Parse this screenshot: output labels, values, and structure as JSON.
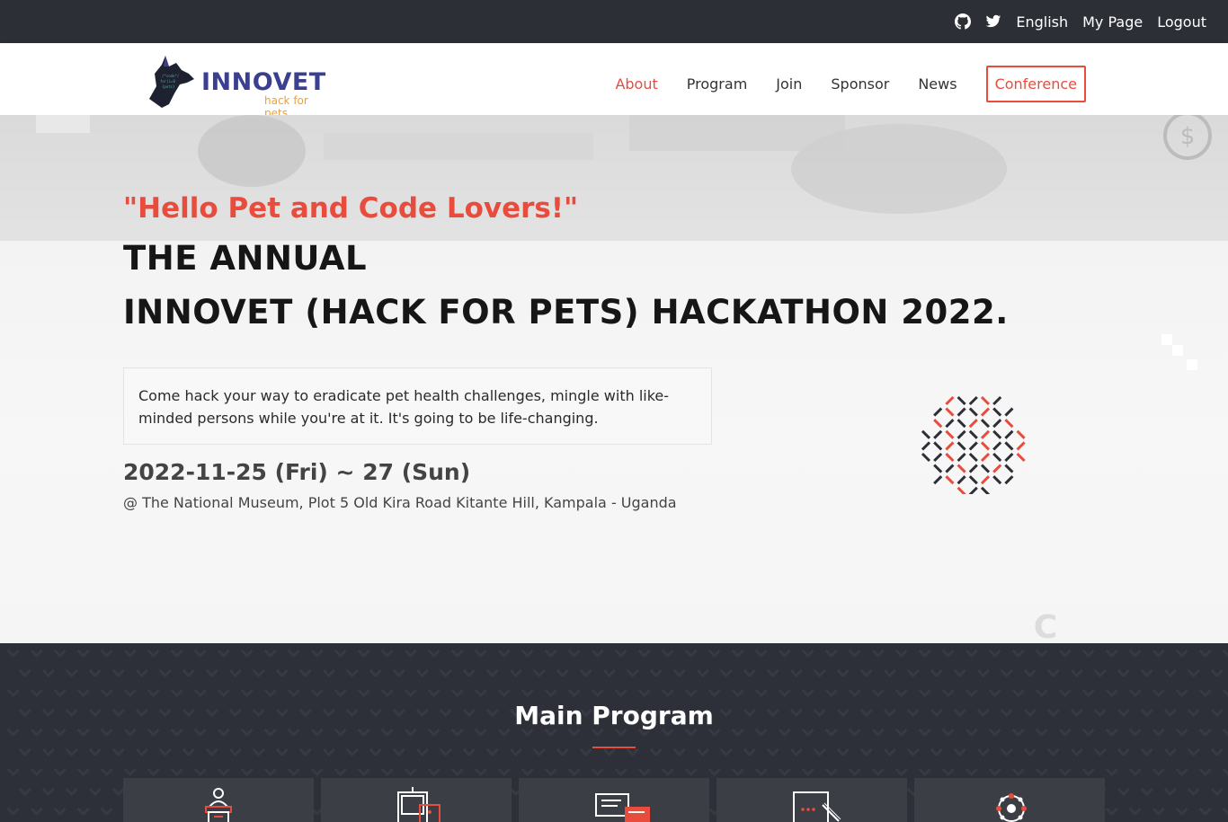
{
  "topbar": {
    "github_icon": "github-icon",
    "twitter_icon": "twitter-icon",
    "language": "English",
    "my_page": "My Page",
    "logout": "Logout"
  },
  "logo": {
    "brand": "INNOVET",
    "tagline": "hack for pets"
  },
  "nav": {
    "items": [
      {
        "label": "About",
        "active": true
      },
      {
        "label": "Program"
      },
      {
        "label": "Join"
      },
      {
        "label": "Sponsor"
      },
      {
        "label": "News"
      },
      {
        "label": "Conference"
      }
    ]
  },
  "hero": {
    "greeting": "\"Hello Pet and Code Lovers!\"",
    "title_line1": "THE ANNUAL",
    "title_line2": "INNOVET (HACK FOR PETS) HACKATHON 2022.",
    "description": "Come hack your way to eradicate pet health challenges, mingle with like-minded persons while you're at it. It's going to be life-changing.",
    "date": "2022-11-25 (Fri) ~ 27 (Sun)",
    "venue": "@ The National Museum, Plot 5 Old Kira Road Kitante Hill, Kampala - Uganda"
  },
  "program": {
    "title": "Main Program",
    "cards": [
      {
        "icon": "podium-speaker-icon"
      },
      {
        "icon": "presentation-board-icon"
      },
      {
        "icon": "chat-messages-icon"
      },
      {
        "icon": "laptop-code-icon"
      },
      {
        "icon": "network-hub-icon"
      }
    ]
  },
  "colors": {
    "accent": "#e84c3d",
    "topbar": "#2d2f36",
    "program_bg": "#2e3039",
    "brand": "#3b3f8f",
    "tagline": "#f0a030"
  }
}
